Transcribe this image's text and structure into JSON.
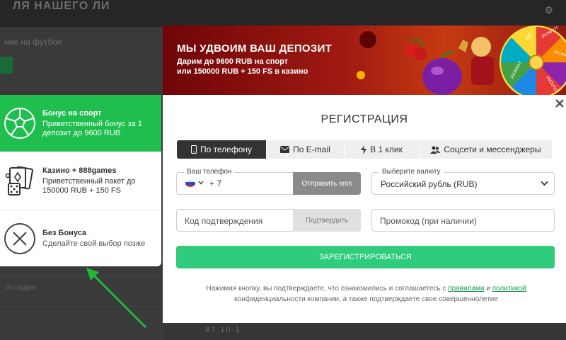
{
  "background": {
    "top_title": "ЛЯ НАШЕГО ЛИ",
    "subtitle": "ние на футбол",
    "row_text": "Эпладия",
    "odds": "47  10  1"
  },
  "bonuses": [
    {
      "title": "Бонус на спорт",
      "desc_line1": "Приветственный бонус за 1",
      "desc_line2": "депозит до 9600 RUB",
      "icon": "soccer-ball-icon",
      "active": true
    },
    {
      "title": "Казино + 888games",
      "desc_line1": "Приветственный пакет до",
      "desc_line2": "150000 RUB + 150 FS",
      "icon": "cards-dice-icon",
      "active": false
    },
    {
      "title": "Без Бонуса",
      "desc_line1": "Сделайте свой выбор позже",
      "desc_line2": "",
      "icon": "close-circle-icon",
      "active": false
    }
  ],
  "banner": {
    "title": "МЫ УДВОИМ ВАШ ДЕПОЗИТ",
    "line2": "Дарим до 9600 RUB на спорт",
    "line3": "или 150000 RUB + 150 FS в казино",
    "wheel_labels": [
      "100",
      "JACKPOT",
      "JACKPOT",
      "JACKPOT",
      "JACKPOT"
    ]
  },
  "modal": {
    "title": "РЕГИСТРАЦИЯ",
    "tabs": [
      {
        "label": "По телефону",
        "icon": "phone-icon",
        "active": true
      },
      {
        "label": "По E-mail",
        "icon": "envelope-icon",
        "active": false
      },
      {
        "label": "В 1 клик",
        "icon": "lightning-icon",
        "active": false
      },
      {
        "label": "Соцсети и мессенджеры",
        "icon": "users-icon",
        "active": false
      }
    ],
    "phone_label": "Ваш телефон",
    "phone_code": "+ 7",
    "sms_button": "Отправить sms",
    "currency_label": "Выберите валюту",
    "currency_value": "Российский рубль (RUB)",
    "code_placeholder": "Код подтверждения",
    "confirm_button": "Подтвердить",
    "promo_placeholder": "Промокод (при наличии)",
    "register_button": "ЗАРЕГИСТРИРОВАТЬСЯ",
    "terms_prefix": "Нажимая кнопку, вы подтверждаете, что ознакомились и соглашаетесь с",
    "terms_link1": "правилами",
    "terms_and": "и",
    "terms_link2": "политикой",
    "terms_suffix": "конфиденциальности компании, а также подтверждаете свое совершеннолетие"
  },
  "colors": {
    "accent_green": "#1fbe4e",
    "register_green": "#2fcc7d",
    "tab_active": "#333333",
    "arrow_green": "#22b83a"
  }
}
